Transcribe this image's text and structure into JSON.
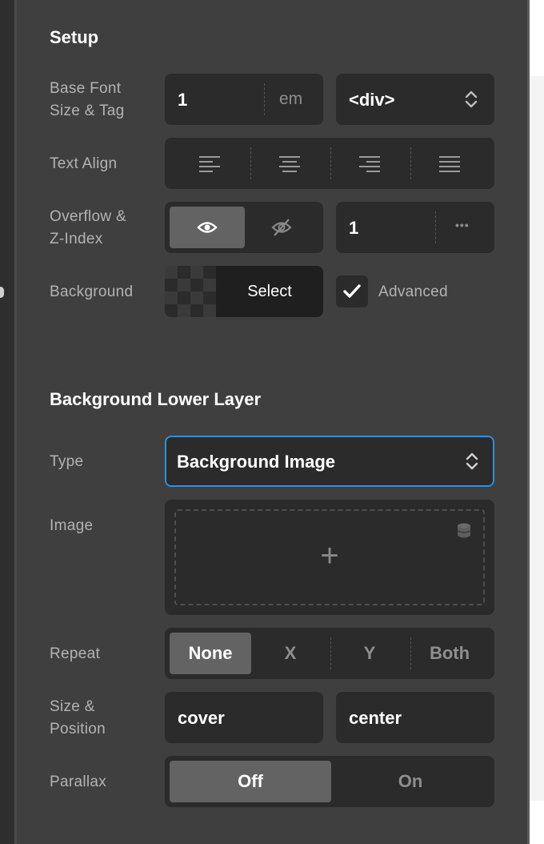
{
  "setup": {
    "title": "Setup",
    "base_font": {
      "label_line1": "Base Font",
      "label_line2": "Size & Tag",
      "value": "1",
      "unit": "em",
      "tag": "<div>"
    },
    "text_align": {
      "label": "Text Align",
      "options": [
        "align-left",
        "align-center",
        "align-right",
        "align-justify"
      ]
    },
    "overflow": {
      "label_line1": "Overflow &",
      "label_line2": "Z-Index",
      "active": "visible",
      "z_index": "1",
      "more": "•••"
    },
    "background": {
      "label": "Background",
      "select_label": "Select",
      "advanced_label": "Advanced",
      "advanced_checked": true
    }
  },
  "lower_layer": {
    "title": "Background Lower Layer",
    "type": {
      "label": "Type",
      "value": "Background Image"
    },
    "image": {
      "label": "Image",
      "plus": "+"
    },
    "repeat": {
      "label": "Repeat",
      "options": [
        "None",
        "X",
        "Y",
        "Both"
      ],
      "selected": "None"
    },
    "size_position": {
      "label_line1": "Size &",
      "label_line2": "Position",
      "size": "cover",
      "position": "center"
    },
    "parallax": {
      "label": "Parallax",
      "off": "Off",
      "on": "On",
      "selected": "Off"
    }
  }
}
